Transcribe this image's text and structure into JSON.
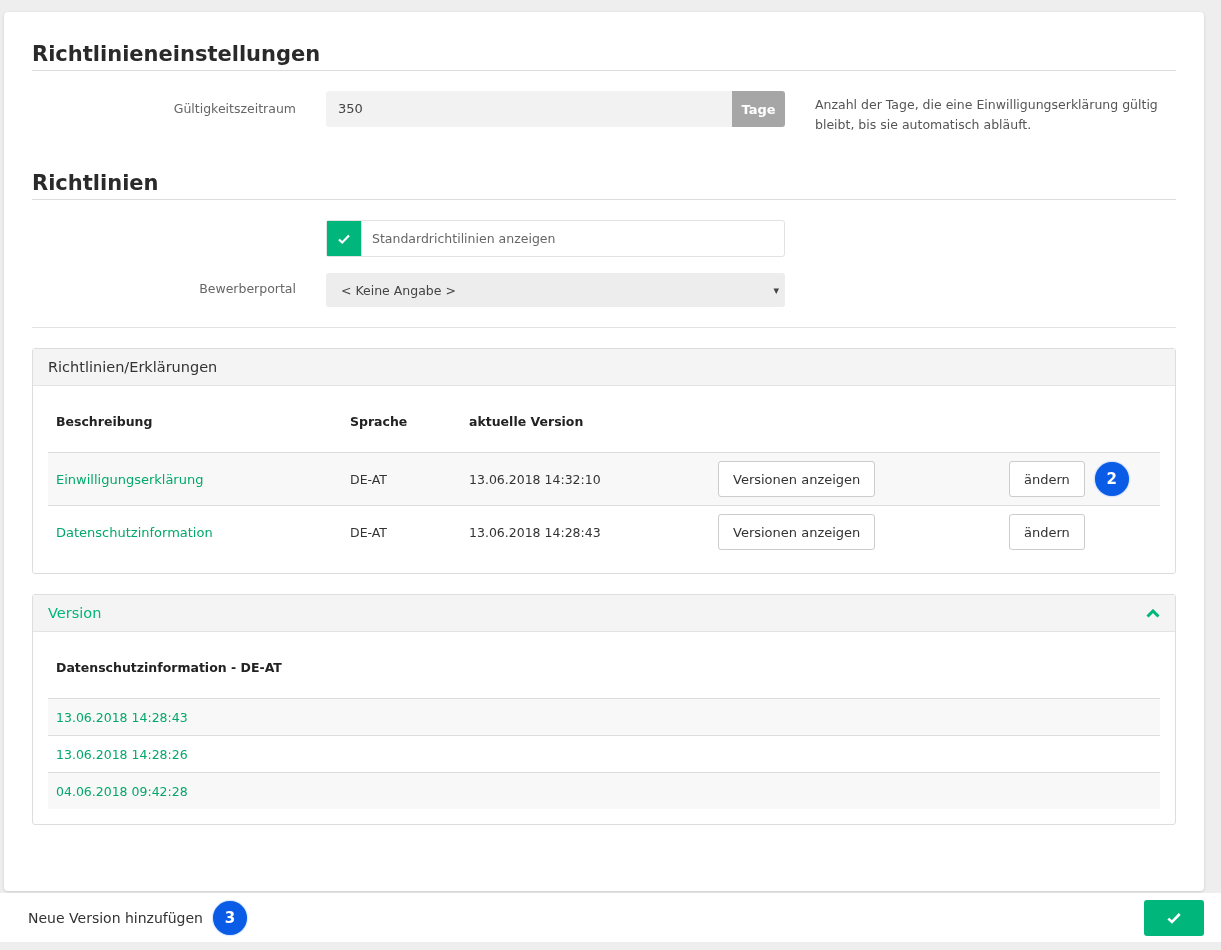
{
  "settings_section": {
    "title": "Richtlinieneinstellungen",
    "validity": {
      "label": "Gültigkeitszeitraum",
      "value": "350",
      "unit": "Tage",
      "hint": "Anzahl der Tage, die eine Einwilligungserklärung gültig bleibt, bis sie automatisch abläuft."
    }
  },
  "policies_section": {
    "title": "Richtlinien",
    "default_checkbox": {
      "label": "Standardrichtilinien anzeigen",
      "checked": true
    },
    "portal": {
      "label": "Bewerberportal",
      "value": "< Keine Angabe >",
      "caret": "▾"
    }
  },
  "policies_panel": {
    "title": "Richtlinien/Erklärungen",
    "columns": [
      "Beschreibung",
      "Sprache",
      "aktuelle Version"
    ],
    "rows": [
      {
        "name": "Einwilligungserklärung",
        "language": "DE-AT",
        "version": "13.06.2018 14:32:10",
        "versions_button": "Versionen anzeigen",
        "edit_button": "ändern",
        "badge": "2"
      },
      {
        "name": "Datenschutzinformation",
        "language": "DE-AT",
        "version": "13.06.2018 14:28:43",
        "versions_button": "Versionen anzeigen",
        "edit_button": "ändern"
      }
    ]
  },
  "version_panel": {
    "title": "Version",
    "expanded": true,
    "heading": "Datenschutzinformation - DE-AT",
    "versions": [
      "13.06.2018 14:28:43",
      "13.06.2018 14:28:26",
      "04.06.2018 09:42:28"
    ]
  },
  "footer": {
    "add_label": "Neue Version hinzufügen",
    "badge": "3"
  }
}
